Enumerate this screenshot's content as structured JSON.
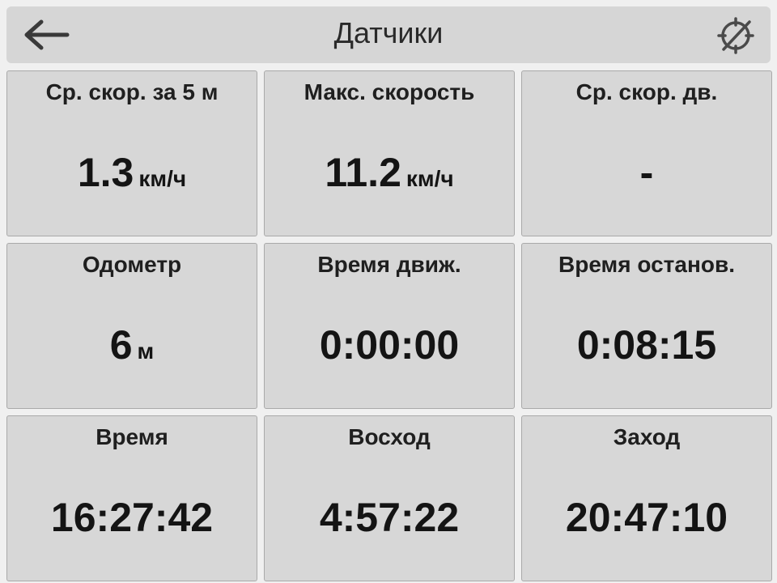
{
  "header": {
    "title": "Датчики",
    "back_icon": "arrow-left-icon",
    "gps_icon": "gps-off-icon"
  },
  "sensors": [
    {
      "label": "Ср. скор. за 5 м",
      "value": "1.3",
      "unit": "км/ч"
    },
    {
      "label": "Макс. скорость",
      "value": "11.2",
      "unit": "км/ч"
    },
    {
      "label": "Ср. скор. дв.",
      "value": "-",
      "unit": ""
    },
    {
      "label": "Одометр",
      "value": "6",
      "unit": "м"
    },
    {
      "label": "Время движ.",
      "value": "0:00:00",
      "unit": ""
    },
    {
      "label": "Время останов.",
      "value": "0:08:15",
      "unit": ""
    },
    {
      "label": "Время",
      "value": "16:27:42",
      "unit": ""
    },
    {
      "label": "Восход",
      "value": "4:57:22",
      "unit": ""
    },
    {
      "label": "Заход",
      "value": "20:47:10",
      "unit": ""
    }
  ],
  "colors": {
    "background": "#f0f0f0",
    "tile": "#d7d7d7",
    "header": "#d6d6d6",
    "text": "#141414"
  }
}
